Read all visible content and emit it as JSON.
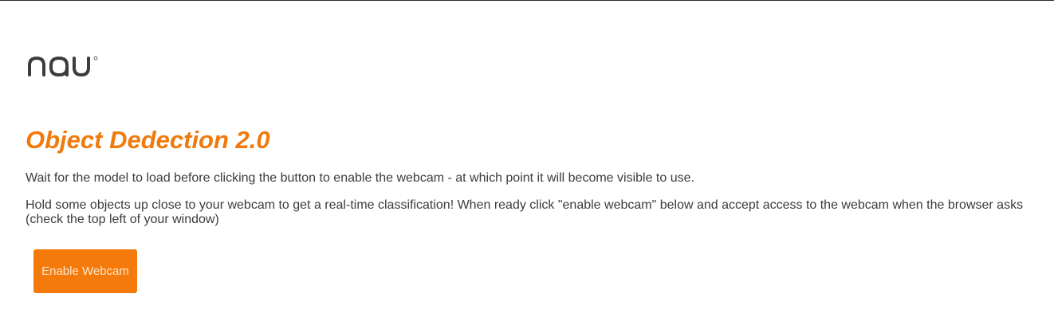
{
  "brand": {
    "logo_icon": "nau-logo",
    "logo_color": "#3c3c3c"
  },
  "main": {
    "title": "Object Dedection 2.0",
    "instructions_1": "Wait for the model to load before clicking the button to enable the webcam - at which point it will become visible to use.",
    "instructions_2": "Hold some objects up close to your webcam to get a real-time classification! When ready click \"enable webcam\" below and accept access to the webcam when the browser asks (check the top left of your window)",
    "enable_button_label": "Enable Webcam"
  },
  "colors": {
    "accent": "#f07a0c",
    "button_bg": "#f47a0b",
    "button_text": "#fde6cf",
    "text": "#3c3c3c"
  }
}
